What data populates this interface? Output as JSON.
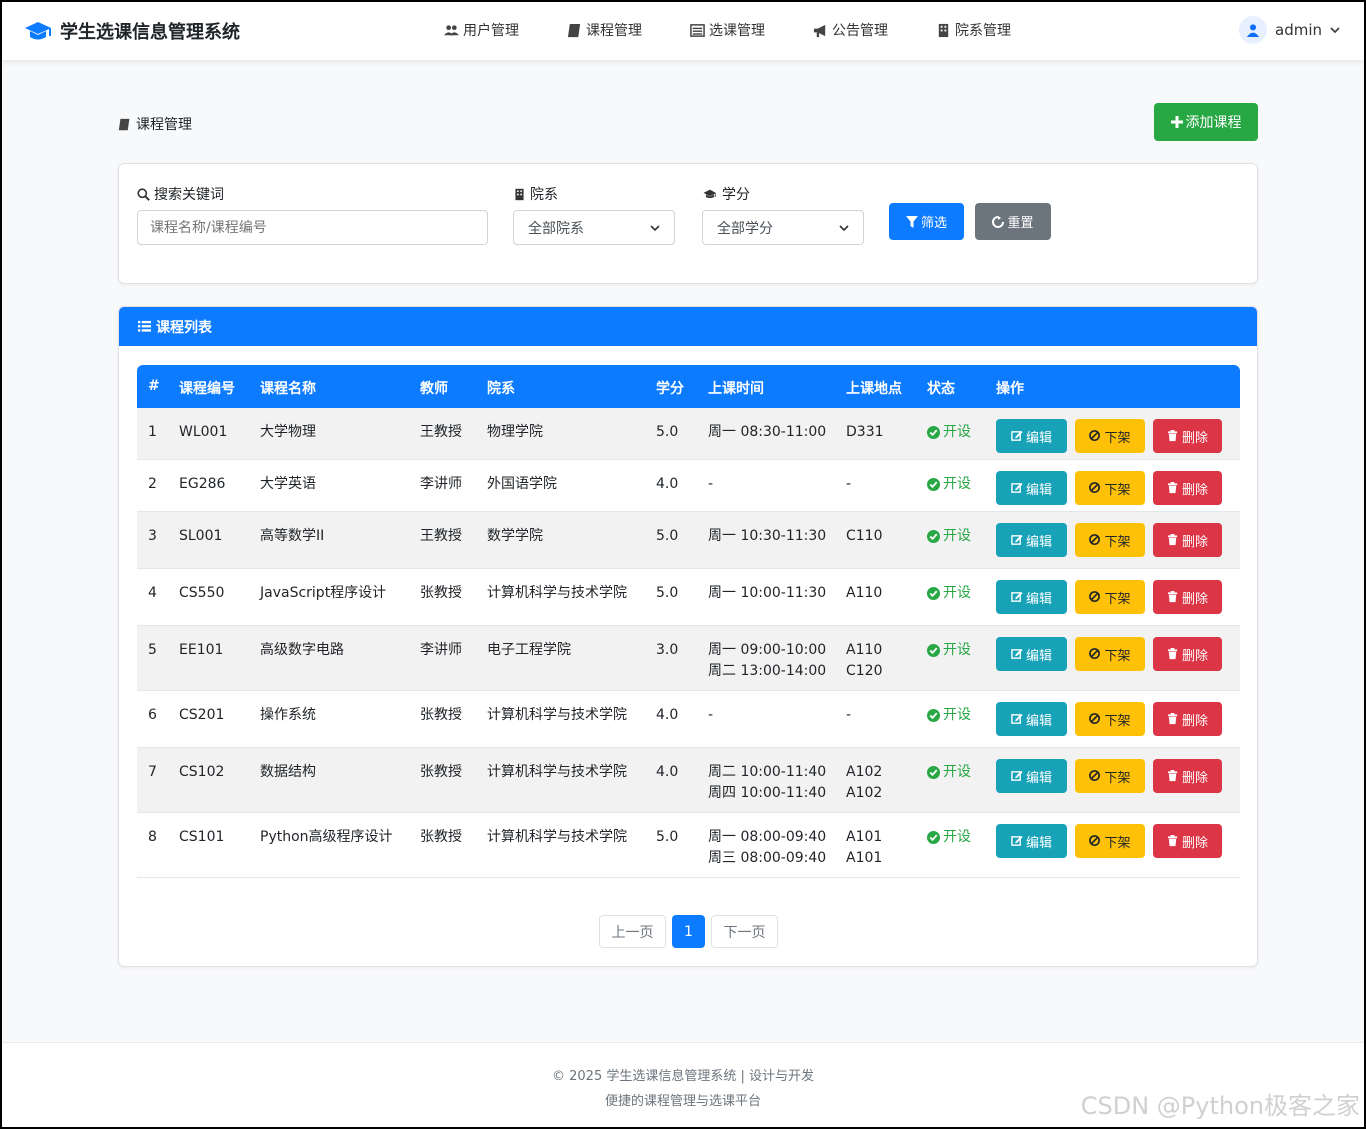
{
  "app": {
    "title": "学生选课信息管理系统"
  },
  "nav": [
    {
      "label": "用户管理",
      "icon": "users-icon"
    },
    {
      "label": "课程管理",
      "icon": "book-icon"
    },
    {
      "label": "选课管理",
      "icon": "list-alt-icon"
    },
    {
      "label": "公告管理",
      "icon": "bullhorn-icon"
    },
    {
      "label": "院系管理",
      "icon": "building-icon"
    }
  ],
  "user": {
    "name": "admin"
  },
  "page": {
    "title": "课程管理",
    "add_label": "添加课程"
  },
  "filter": {
    "keyword_label": "搜索关键词",
    "keyword_placeholder": "课程名称/课程编号",
    "dept_label": "院系",
    "dept_value": "全部院系",
    "credit_label": "学分",
    "credit_value": "全部学分",
    "filter_label": "筛选",
    "reset_label": "重置"
  },
  "list": {
    "title": "课程列表",
    "columns": [
      "#",
      "课程编号",
      "课程名称",
      "教师",
      "院系",
      "学分",
      "上课时间",
      "上课地点",
      "状态",
      "操作"
    ],
    "rows": [
      {
        "no": "1",
        "code": "WL001",
        "name": "大学物理",
        "teacher": "王教授",
        "dept": "物理学院",
        "credit": "5.0",
        "time": "周一 08:30-11:00",
        "time2": "",
        "place": "D331",
        "place2": "",
        "status": "开设"
      },
      {
        "no": "2",
        "code": "EG286",
        "name": "大学英语",
        "teacher": "李讲师",
        "dept": "外国语学院",
        "credit": "4.0",
        "time": "-",
        "time2": "",
        "place": "-",
        "place2": "",
        "status": "开设"
      },
      {
        "no": "3",
        "code": "SL001",
        "name": "高等数学II",
        "teacher": "王教授",
        "dept": "数学学院",
        "credit": "5.0",
        "time": "周一 10:30-11:30",
        "time2": "",
        "place": "C110",
        "place2": "",
        "status": "开设"
      },
      {
        "no": "4",
        "code": "CS550",
        "name": "JavaScript程序设计",
        "teacher": "张教授",
        "dept": "计算机科学与技术学院",
        "credit": "5.0",
        "time": "周一 10:00-11:30",
        "time2": "",
        "place": "A110",
        "place2": "",
        "status": "开设"
      },
      {
        "no": "5",
        "code": "EE101",
        "name": "高级数字电路",
        "teacher": "李讲师",
        "dept": "电子工程学院",
        "credit": "3.0",
        "time": "周一 09:00-10:00",
        "time2": "周二 13:00-14:00",
        "place": "A110",
        "place2": "C120",
        "status": "开设"
      },
      {
        "no": "6",
        "code": "CS201",
        "name": "操作系统",
        "teacher": "张教授",
        "dept": "计算机科学与技术学院",
        "credit": "4.0",
        "time": "-",
        "time2": "",
        "place": "-",
        "place2": "",
        "status": "开设"
      },
      {
        "no": "7",
        "code": "CS102",
        "name": "数据结构",
        "teacher": "张教授",
        "dept": "计算机科学与技术学院",
        "credit": "4.0",
        "time": "周二 10:00-11:40",
        "time2": "周四 10:00-11:40",
        "place": "A102",
        "place2": "A102",
        "status": "开设"
      },
      {
        "no": "8",
        "code": "CS101",
        "name": "Python高级程序设计",
        "teacher": "张教授",
        "dept": "计算机科学与技术学院",
        "credit": "5.0",
        "time": "周一 08:00-09:40",
        "time2": "周三 08:00-09:40",
        "place": "A101",
        "place2": "A101",
        "status": "开设"
      }
    ],
    "actions": {
      "edit": "编辑",
      "off": "下架",
      "delete": "删除"
    }
  },
  "pagination": {
    "prev": "上一页",
    "current": "1",
    "next": "下一页"
  },
  "footer": {
    "line1": "© 2025 学生选课信息管理系统 | 设计与开发",
    "line2": "便捷的课程管理与选课平台"
  },
  "watermark": "CSDN @Python极客之家",
  "colors": {
    "primary": "#0d7bff",
    "success": "#28a745",
    "info": "#17a2b8",
    "warning": "#ffc107",
    "danger": "#dc3545",
    "secondary": "#6c757d"
  }
}
